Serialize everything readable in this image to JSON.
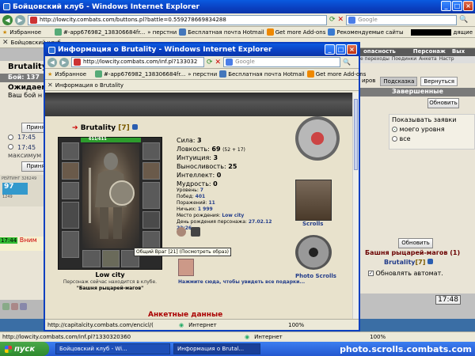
{
  "outer_window": {
    "title": "Бойцовский клуб - Windows Internet Explorer",
    "address": "http://lowcity.combats.com/buttons.pl?battle=0.559278669834288",
    "search_placeholder": "Google",
    "favorites_label": "Избранное",
    "fav_items": [
      "#-app676982_138306684fr...",
      "» перстни",
      "Бесплатная почта Hotmail",
      "Get more Add-ons",
      "Рекомендуемые сайты",
      "дящие"
    ],
    "tab_label": "Бойцовский клуб",
    "status_url": "http://lowcity.combats.com/inf.pl?1330320360",
    "status_zone": "Интернет",
    "status_zoom": "100%"
  },
  "game_left": {
    "char_name": "Brutality",
    "fight_label": "Бой:",
    "fight_value": "137",
    "waiting": "Ожидаем",
    "your_label": "Ваш бой н",
    "accept_btn": "Приня",
    "time1": "17:45",
    "time2": "17:45",
    "max_label": "максимум",
    "accept_btn2": "Приня",
    "chat_time": "17:44",
    "chat_text": "Вним",
    "rating": "РЕЙТИНГ",
    "rating_num": "326249",
    "counter_num": "97",
    "counter_extra": "1249"
  },
  "game_right": {
    "top_menu": [
      "опасность",
      "Персонаж",
      "Вых"
    ],
    "sub_menu": [
      "е переходы",
      "Поединки",
      "Анкета",
      "Настр"
    ],
    "tabs": [
      "иров",
      "Подсказка",
      "Вернуться"
    ],
    "completed": "Завершенные",
    "refresh_btn": "Обновить",
    "show_requests": "Показывать заявки",
    "opt_my_level": "моего уровня",
    "opt_all": "все",
    "refresh_btn2": "Обновить",
    "tower_title": "Башня рыцарей-магов (1)",
    "tower_player": "Brutality",
    "tower_player_level": "[7]",
    "auto_refresh": "Обновлять автомат.",
    "clock": "17:48"
  },
  "inner_window": {
    "title": "Информация о Brutality - Windows Internet Explorer",
    "address": "http://lowcity.combats.com/inf.pl?133032",
    "search_placeholder": "Google",
    "favorites_label": "Избранное",
    "fav_items": [
      "#-app676982_138306684fr...",
      "» перстни",
      "Бесплатная почта Hotmail",
      "Get more Add-ons"
    ],
    "tab_label": "Информация о Brutality",
    "status_url": "http://capitalcity.combats.com/encicl/(",
    "status_zone": "Интернет",
    "status_zoom": "100%"
  },
  "profile": {
    "name": "Brutality",
    "level": "[7]",
    "hp": "611/611",
    "city": "Low city",
    "location_text": "Персонаж сейчас находится в клубе.",
    "location_place": "\"Башня рыцарей-магов\"",
    "stats": [
      {
        "label": "Сила:",
        "value": "3",
        "extra": ""
      },
      {
        "label": "Ловкость:",
        "value": "69",
        "extra": "(52 + 17)"
      },
      {
        "label": "Интуиция:",
        "value": "3",
        "extra": ""
      },
      {
        "label": "Выносливость:",
        "value": "25",
        "extra": ""
      },
      {
        "label": "Интеллект:",
        "value": "0",
        "extra": ""
      },
      {
        "label": "Мудрость:",
        "value": "0",
        "extra": ""
      }
    ],
    "info": [
      {
        "label": "Уровень:",
        "value": "7"
      },
      {
        "label": "Побед:",
        "value": "401"
      },
      {
        "label": "Поражений:",
        "value": "11"
      },
      {
        "label": "Ничьих:",
        "value": "1 999"
      },
      {
        "label": "Место рождения:",
        "value": "Low city"
      },
      {
        "label": "День рождения персонажа:",
        "value": "27.02.12 22:26"
      }
    ],
    "tooltip": "Общий Враг [21] (Посмотреть образ)",
    "click_here": "Нажмите сюда, чтобы увидеть все подарки...",
    "scrolls_label": "Scrolls",
    "photo_scrolls_label": "Photo Scrolls",
    "anketa": "Анкетные данные"
  },
  "taskbar": {
    "start": "пуск",
    "tasks": [
      "Бойцовский клуб - Wi...",
      "Информация о Brutal..."
    ],
    "watermark": "photo.scrolls.combats.com"
  }
}
